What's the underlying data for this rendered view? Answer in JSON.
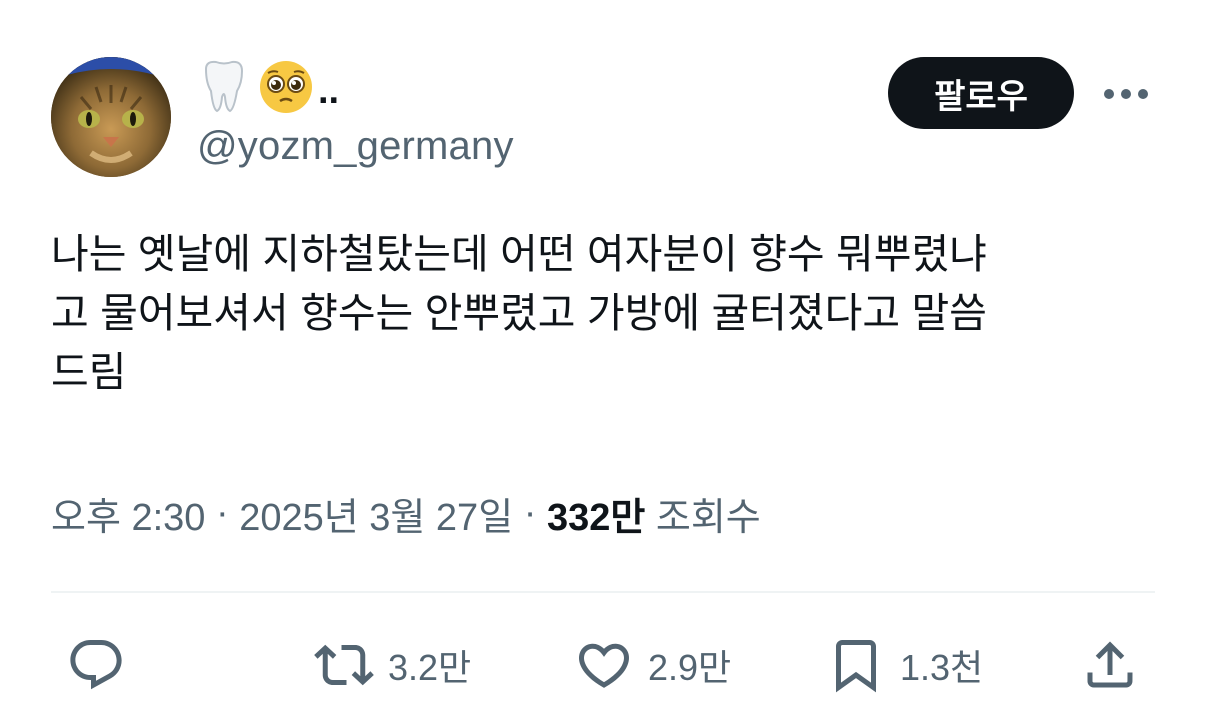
{
  "user": {
    "display_name_icons": [
      "tooth-icon",
      "pleading-face-icon"
    ],
    "display_name_suffix": "..",
    "handle": "@yozm_germany"
  },
  "header": {
    "follow_label": "팔로우",
    "more_icon": "more-dots-icon"
  },
  "tweet": {
    "text": "나는 옛날에 지하철탔는데 어떤 여자분이 향수 뭐뿌렸냐\n고 물어보셔서 향수는 안뿌렸고 가방에 귤터졌다고 말씀\n드림",
    "time": "오후 2:30",
    "sep1": " · ",
    "date": "2025년 3월 27일",
    "sep2": " · ",
    "views_count": "332만",
    "views_label": " 조회수"
  },
  "actions": {
    "reply_icon": "reply-icon",
    "retweet_count": "3.2만",
    "like_count": "2.9만",
    "bookmark_count": "1.3천",
    "share_icon": "share-icon"
  },
  "colors": {
    "text_primary": "#0f1419",
    "text_secondary": "#536471",
    "button_bg": "#0f1419",
    "divider": "#eff3f4"
  }
}
